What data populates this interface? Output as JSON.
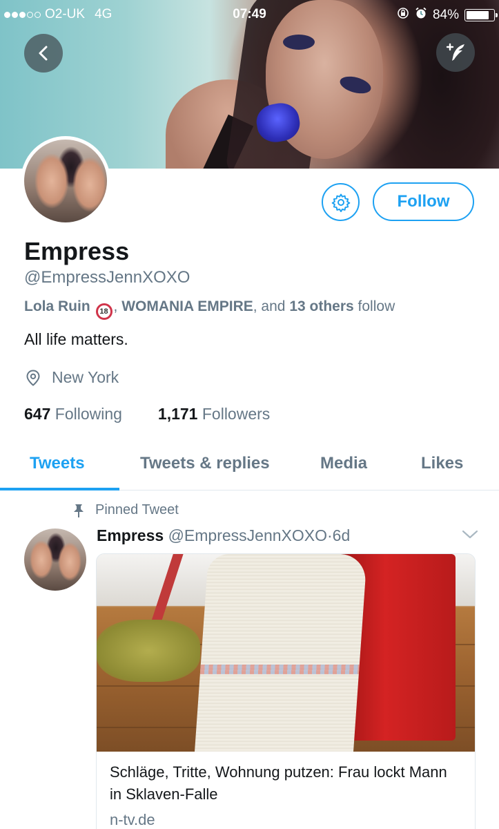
{
  "status_bar": {
    "carrier": "O2-UK",
    "network": "4G",
    "time": "07:49",
    "battery": "84%",
    "battery_level": 0.84
  },
  "profile": {
    "name": "Empress",
    "handle": "@EmpressJennXOXO",
    "followed_by": {
      "first": "Lola Ruin",
      "first_badge": "18",
      "separator": ",",
      "second": "WOMANIA EMPIRE",
      "and_text": ", and",
      "count_text": "13 others",
      "suffix": "follow"
    },
    "bio": "All life matters.",
    "location": "New York",
    "following_count": "647",
    "following_label": "Following",
    "followers_count": "1,171",
    "followers_label": "Followers",
    "follow_button": "Follow"
  },
  "tabs": [
    {
      "label": "Tweets",
      "active": true
    },
    {
      "label": "Tweets & replies",
      "active": false
    },
    {
      "label": "Media",
      "active": false
    },
    {
      "label": "Likes",
      "active": false
    }
  ],
  "tweet": {
    "pinned_label": "Pinned Tweet",
    "author_name": "Empress",
    "author_handle": "@EmpressJennXOXO",
    "separator": "·",
    "age": "6d",
    "card": {
      "title": "Schläge, Tritte, Wohnung putzen: Frau lockt Mann in Sklaven-Falle",
      "domain": "n-tv.de"
    }
  },
  "icons": {
    "back": "back-arrow-icon",
    "compose": "compose-tweet-icon",
    "settings": "gear-icon",
    "location": "location-pin-icon",
    "pin": "pin-icon",
    "chevron": "chevron-down-icon"
  },
  "colors": {
    "accent": "#1da1f2",
    "secondary_text": "#657786",
    "primary_text": "#14171a"
  }
}
